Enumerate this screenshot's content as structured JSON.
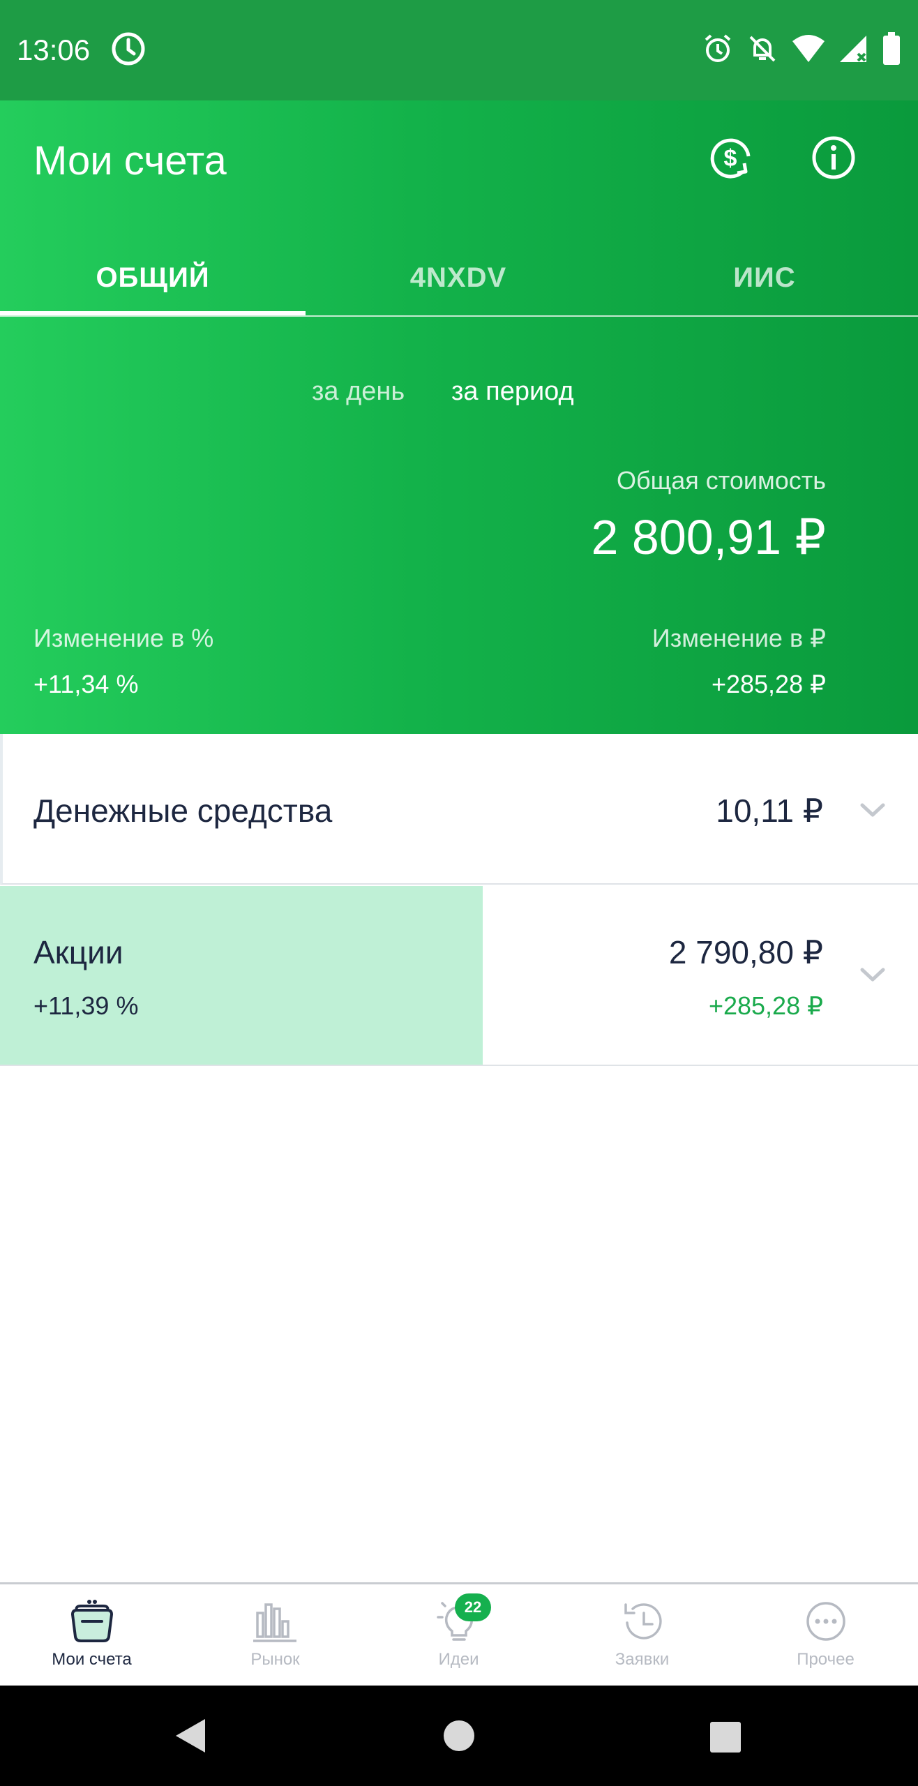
{
  "status_bar": {
    "time": "13:06",
    "icons": [
      "clock-icon",
      "alarm-icon",
      "notifications-off-icon",
      "wifi-icon",
      "signal-icon",
      "battery-icon"
    ]
  },
  "header": {
    "title": "Мои счета",
    "actions": [
      "currency-exchange-icon",
      "info-icon"
    ]
  },
  "tabs": [
    {
      "label": "ОБЩИЙ",
      "active": true
    },
    {
      "label": "4NXDV",
      "active": false
    },
    {
      "label": "ИИС",
      "active": false
    }
  ],
  "period": {
    "day_label": "за день",
    "period_label": "за период",
    "selected": "за период"
  },
  "summary": {
    "total_label": "Общая стоимость",
    "total_value": "2 800,91 ₽",
    "change_pct_label": "Изменение в  %",
    "change_pct_value": "+11,34  %",
    "change_rub_label": "Изменение в ₽",
    "change_rub_value": "+285,28 ₽"
  },
  "rows": {
    "cash": {
      "title": "Денежные средства",
      "amount": "10,11 ₽"
    },
    "stocks": {
      "title": "Акции",
      "change_pct": "+11,39  %",
      "amount": "2 790,80 ₽",
      "change_rub": "+285,28 ₽",
      "bar_fraction": 0.526
    }
  },
  "bottom_nav": [
    {
      "label": "Мои счета",
      "icon": "wallet-icon",
      "active": true
    },
    {
      "label": "Рынок",
      "icon": "market-chart-icon",
      "active": false
    },
    {
      "label": "Идеи",
      "icon": "lightbulb-icon",
      "active": false,
      "badge": "22"
    },
    {
      "label": "Заявки",
      "icon": "history-icon",
      "active": false
    },
    {
      "label": "Прочее",
      "icon": "more-icon",
      "active": false
    }
  ],
  "colors": {
    "accent_green": "#15b04e",
    "text_dark": "#1d2740",
    "stocks_fill": "#bff0d6",
    "nav_inactive": "#b6bac2"
  }
}
